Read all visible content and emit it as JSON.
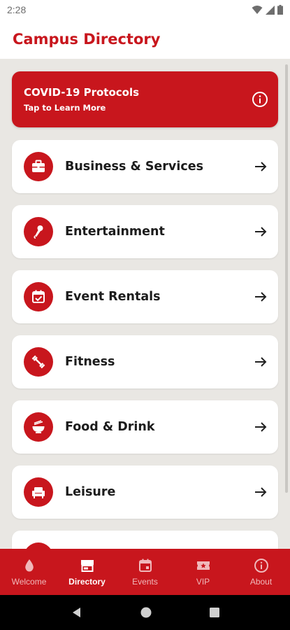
{
  "status_bar": {
    "time": "2:28"
  },
  "header": {
    "title": "Campus Directory"
  },
  "banner": {
    "title": "COVID-19 Protocols",
    "subtitle": "Tap to Learn More",
    "icon": "info-icon"
  },
  "categories": [
    {
      "label": "Business & Services",
      "icon": "briefcase-icon"
    },
    {
      "label": "Entertainment",
      "icon": "microphone-icon"
    },
    {
      "label": "Event Rentals",
      "icon": "calendar-check-icon"
    },
    {
      "label": "Fitness",
      "icon": "dumbbell-icon"
    },
    {
      "label": "Food & Drink",
      "icon": "bowl-icon"
    },
    {
      "label": "Leisure",
      "icon": "armchair-icon"
    },
    {
      "label": "",
      "icon": ""
    }
  ],
  "bottom_nav": [
    {
      "label": "Welcome",
      "icon": "droplet-icon",
      "active": false
    },
    {
      "label": "Directory",
      "icon": "storefront-icon",
      "active": true
    },
    {
      "label": "Events",
      "icon": "calendar-icon",
      "active": false
    },
    {
      "label": "VIP",
      "icon": "ticket-star-icon",
      "active": false
    },
    {
      "label": "About",
      "icon": "info-icon",
      "active": false
    }
  ],
  "colors": {
    "accent": "#c8161d",
    "background": "#e9e7e3",
    "card": "#ffffff"
  }
}
